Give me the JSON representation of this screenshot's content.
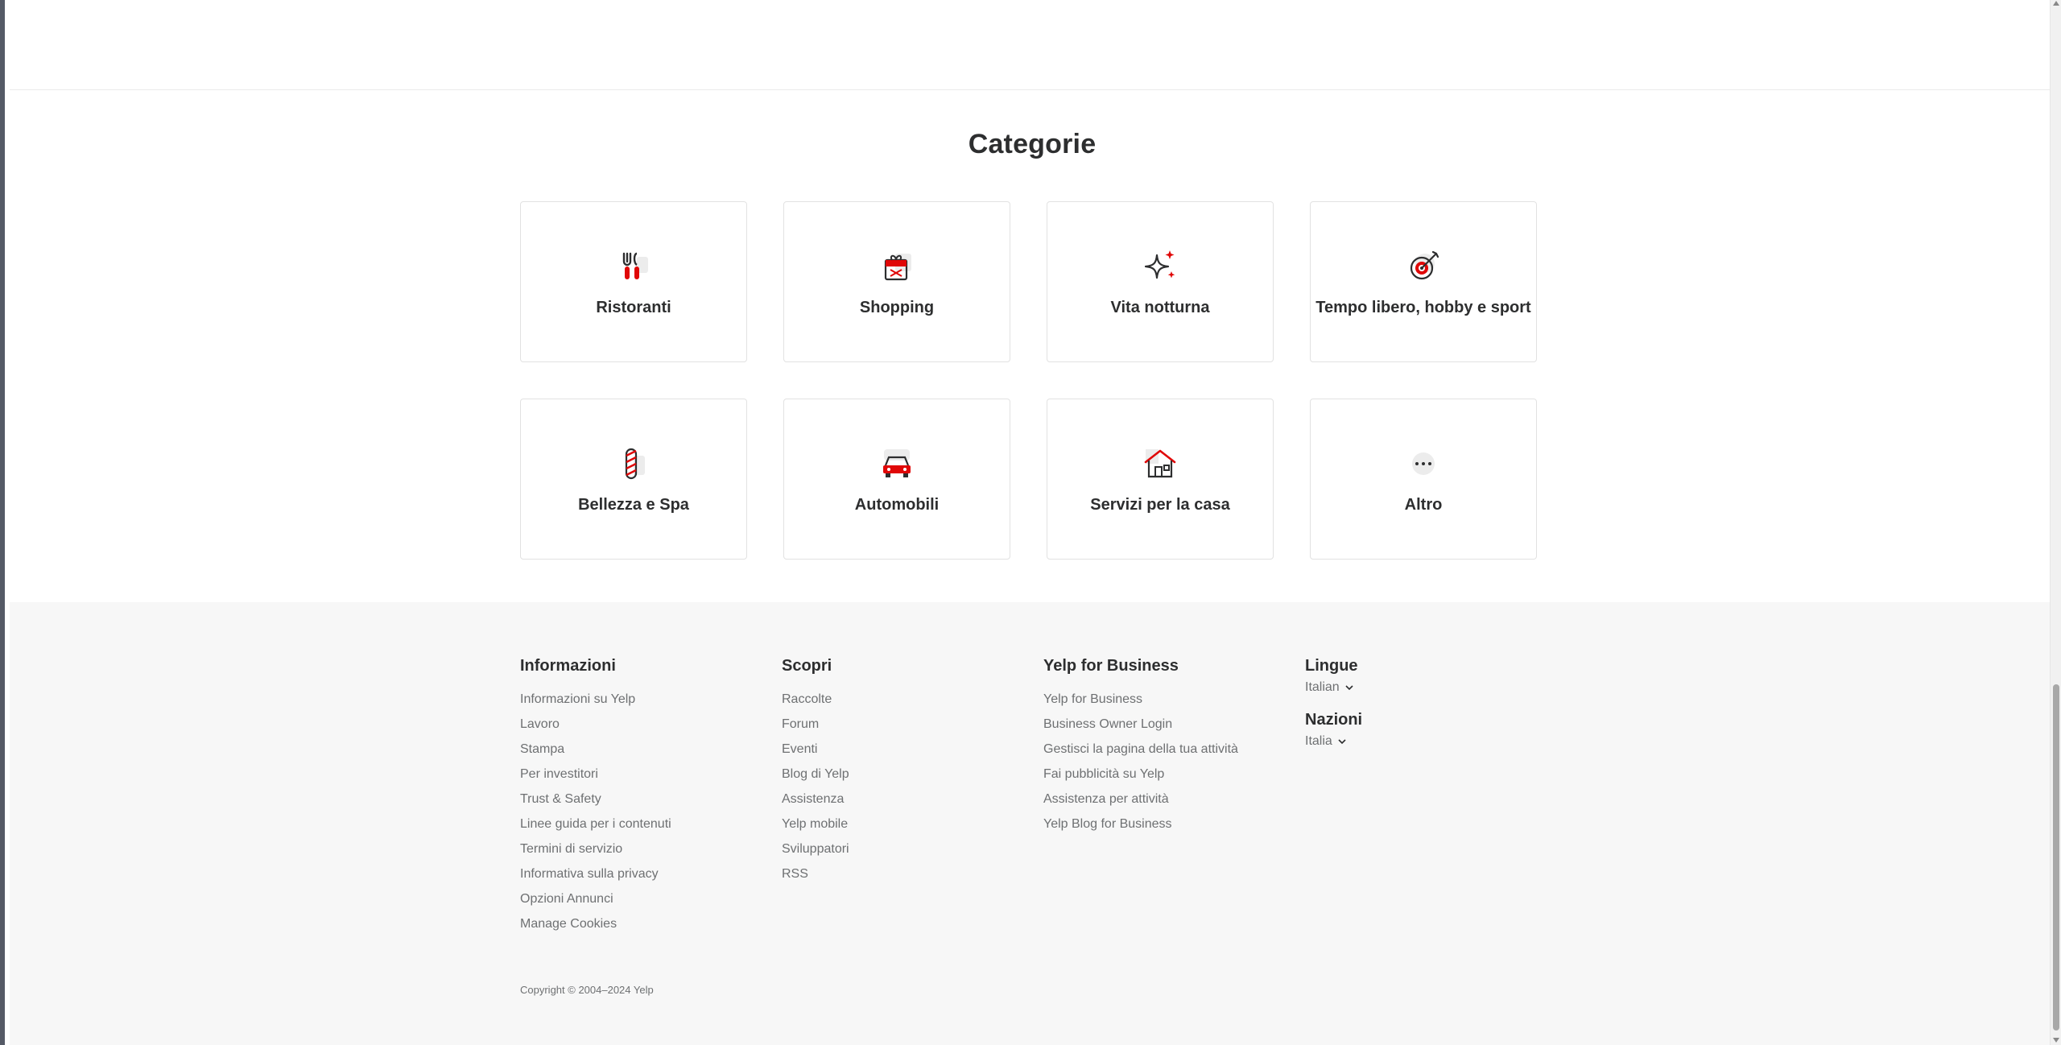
{
  "categories": {
    "title": "Categorie",
    "items": [
      {
        "label": "Ristoranti",
        "icon": "restaurant-icon"
      },
      {
        "label": "Shopping",
        "icon": "shopping-gift-icon"
      },
      {
        "label": "Vita notturna",
        "icon": "nightlife-sparkle-icon"
      },
      {
        "label": "Tempo libero, hobby e sport",
        "icon": "target-icon"
      },
      {
        "label": "Bellezza e Spa",
        "icon": "barber-pole-icon"
      },
      {
        "label": "Automobili",
        "icon": "car-icon"
      },
      {
        "label": "Servizi per la casa",
        "icon": "house-icon"
      },
      {
        "label": "Altro",
        "icon": "more-dots-icon"
      }
    ]
  },
  "footer": {
    "informazioni": {
      "heading": "Informazioni",
      "links": [
        "Informazioni su Yelp",
        "Lavoro",
        "Stampa",
        "Per investitori",
        "Trust & Safety",
        "Linee guida per i contenuti",
        "Termini di servizio",
        "Informativa sulla privacy",
        "Opzioni Annunci",
        "Manage Cookies"
      ]
    },
    "scopri": {
      "heading": "Scopri",
      "links": [
        "Raccolte",
        "Forum",
        "Eventi",
        "Blog di Yelp",
        "Assistenza",
        "Yelp mobile",
        "Sviluppatori",
        "RSS"
      ]
    },
    "business": {
      "heading": "Yelp for Business",
      "links": [
        "Yelp for Business",
        "Business Owner Login",
        "Gestisci la pagina della tua attività",
        "Fai pubblicità su Yelp",
        "Assistenza per attività",
        "Yelp Blog for Business"
      ]
    },
    "lingue": {
      "heading": "Lingue",
      "value": "Italian"
    },
    "nazioni": {
      "heading": "Nazioni",
      "value": "Italia"
    },
    "copyright": "Copyright © 2004–2024 Yelp"
  },
  "colors": {
    "accent": "#e00707",
    "text": "#2d2e2f",
    "muted": "#6e7072",
    "footer_bg": "#f7f7f7"
  }
}
